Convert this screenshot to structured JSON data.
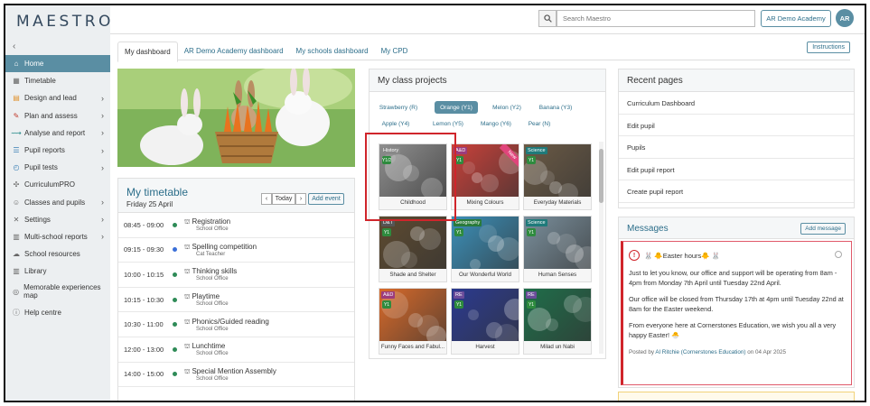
{
  "app": {
    "logo": "MAESTRO",
    "collapse_glyph": "‹"
  },
  "sidebar": {
    "items": [
      {
        "label": "Home",
        "icon": "home-icon",
        "glyph": "⌂",
        "active": true,
        "chevron": false
      },
      {
        "label": "Timetable",
        "icon": "calendar-icon",
        "glyph": "▦",
        "active": false,
        "chevron": false
      },
      {
        "label": "Design and lead",
        "icon": "design-icon",
        "glyph": "▤",
        "active": false,
        "chevron": true
      },
      {
        "label": "Plan and assess",
        "icon": "plan-icon",
        "glyph": "✎",
        "active": false,
        "chevron": true
      },
      {
        "label": "Analyse and report",
        "icon": "analyse-icon",
        "glyph": "⟿",
        "active": false,
        "chevron": true
      },
      {
        "label": "Pupil reports",
        "icon": "pupil-reports-icon",
        "glyph": "☰",
        "active": false,
        "chevron": true
      },
      {
        "label": "Pupil tests",
        "icon": "pupil-tests-icon",
        "glyph": "◴",
        "active": false,
        "chevron": true
      },
      {
        "label": "CurriculumPRO",
        "icon": "curriculumpro-icon",
        "glyph": "✣",
        "active": false,
        "chevron": false
      },
      {
        "label": "Classes and pupils",
        "icon": "classes-icon",
        "glyph": "☺",
        "active": false,
        "chevron": true
      },
      {
        "label": "Settings",
        "icon": "settings-icon",
        "glyph": "✕",
        "active": false,
        "chevron": true
      },
      {
        "label": "Multi-school reports",
        "icon": "multi-school-icon",
        "glyph": "▥",
        "active": false,
        "chevron": true
      },
      {
        "label": "School resources",
        "icon": "cloud-icon",
        "glyph": "☁",
        "active": false,
        "chevron": false
      },
      {
        "label": "Library",
        "icon": "library-icon",
        "glyph": "▥",
        "active": false,
        "chevron": false
      },
      {
        "label": "Memorable experiences map",
        "icon": "map-icon",
        "glyph": "◎",
        "active": false,
        "chevron": false
      },
      {
        "label": "Help centre",
        "icon": "help-icon",
        "glyph": "ⓘ",
        "active": false,
        "chevron": false
      }
    ]
  },
  "header": {
    "search_placeholder": "Search Maestro",
    "school_button": "AR Demo Academy",
    "avatar_initials": "AR"
  },
  "tabs": [
    {
      "label": "My dashboard",
      "active": true
    },
    {
      "label": "AR Demo Academy dashboard",
      "active": false
    },
    {
      "label": "My schools dashboard",
      "active": false
    },
    {
      "label": "My CPD",
      "active": false
    }
  ],
  "instructions_label": "Instructions",
  "timetable": {
    "title": "My timetable",
    "date": "Friday 25 April",
    "prev_glyph": "‹",
    "today_label": "Today",
    "next_glyph": "›",
    "add_event_label": "Add event",
    "rows": [
      {
        "time": "08:45 - 09:00",
        "name": "Registration",
        "sub": "School Office",
        "dot": "#2e8b57"
      },
      {
        "time": "09:15 - 09:30",
        "name": "Spelling competition",
        "sub": "Cat Teacher",
        "dot": "#3a6fd8"
      },
      {
        "time": "10:00 - 10:15",
        "name": "Thinking skills",
        "sub": "School Office",
        "dot": "#2e8b57"
      },
      {
        "time": "10:15 - 10:30",
        "name": "Playtime",
        "sub": "School Office",
        "dot": "#2e8b57"
      },
      {
        "time": "10:30 - 11:00",
        "name": "Phonics/Guided reading",
        "sub": "School Office",
        "dot": "#2e8b57"
      },
      {
        "time": "12:00 - 13:00",
        "name": "Lunchtime",
        "sub": "School Office",
        "dot": "#2e8b57"
      },
      {
        "time": "14:00 - 15:00",
        "name": "Special Mention Assembly",
        "sub": "School Office",
        "dot": "#2e8b57"
      }
    ]
  },
  "class_projects": {
    "title": "My class projects",
    "pills": [
      {
        "label": "Strawberry (R)",
        "active": false
      },
      {
        "label": "Orange (Y1)",
        "active": true
      },
      {
        "label": "Melon (Y2)",
        "active": false
      },
      {
        "label": "Banana (Y3)",
        "active": false
      },
      {
        "label": "Apple (Y4)",
        "active": false
      },
      {
        "label": "Lemon (Y5)",
        "active": false
      },
      {
        "label": "Mango (Y6)",
        "active": false
      },
      {
        "label": "Pear (N)",
        "active": false
      }
    ],
    "cards": [
      {
        "label": "Childhood",
        "tag": "History",
        "tag_color": "#888888",
        "year": "Y1/2",
        "bg": "#8f8f8f"
      },
      {
        "label": "Mixing Colours",
        "tag": "A&D",
        "tag_color": "#9c3b7c",
        "year": "Y1",
        "bg": "#c9413a",
        "ribbon": "New"
      },
      {
        "label": "Everyday Materials",
        "tag": "Science",
        "tag_color": "#1f7a7a",
        "year": "Y1",
        "bg": "#6b5a45"
      },
      {
        "label": "Shade and Shelter",
        "tag": "D&T",
        "tag_color": "#555555",
        "year": "Y1",
        "bg": "#5d4a30"
      },
      {
        "label": "Our Wonderful World",
        "tag": "Geography",
        "tag_color": "#2a7a3a",
        "year": "Y1",
        "bg": "#3b8fb8"
      },
      {
        "label": "Human Senses",
        "tag": "Science",
        "tag_color": "#1f7a7a",
        "year": "Y1",
        "bg": "#7a8f9c"
      },
      {
        "label": "Funny Faces and Fabul...",
        "tag": "A&D",
        "tag_color": "#9c3b7c",
        "year": "Y1",
        "bg": "#d86a2a"
      },
      {
        "label": "Harvest",
        "tag": "RE",
        "tag_color": "#6b4c9a",
        "year": "Y1",
        "bg": "#2b3a8f"
      },
      {
        "label": "Milad un Nabi",
        "tag": "RE",
        "tag_color": "#6b4c9a",
        "year": "Y1",
        "bg": "#1f6e4a"
      }
    ]
  },
  "recent_pages": {
    "title": "Recent pages",
    "items": [
      "Curriculum Dashboard",
      "Edit pupil",
      "Pupils",
      "Edit pupil report",
      "Create pupil report"
    ]
  },
  "messages": {
    "title": "Messages",
    "add_label": "Add message",
    "warn_glyph": "!",
    "heading": "🐰 🐥Easter hours🐥 🐰",
    "paragraphs": [
      "Just to let you know, our office and support will be operating from 8am - 4pm from Monday 7th April until Tuesday 22nd April.",
      "Our office will be closed from Thursday 17th at 4pm until Tuesday 22nd at 8am for the Easter weekend.",
      "From everyone here at Cornerstones Education, we wish you all a very happy Easter! 🐣"
    ],
    "posted_prefix": "Posted by",
    "posted_author": "Al Ritchie (Cornerstones Education)",
    "posted_suffix": "on 04 Apr 2025"
  }
}
